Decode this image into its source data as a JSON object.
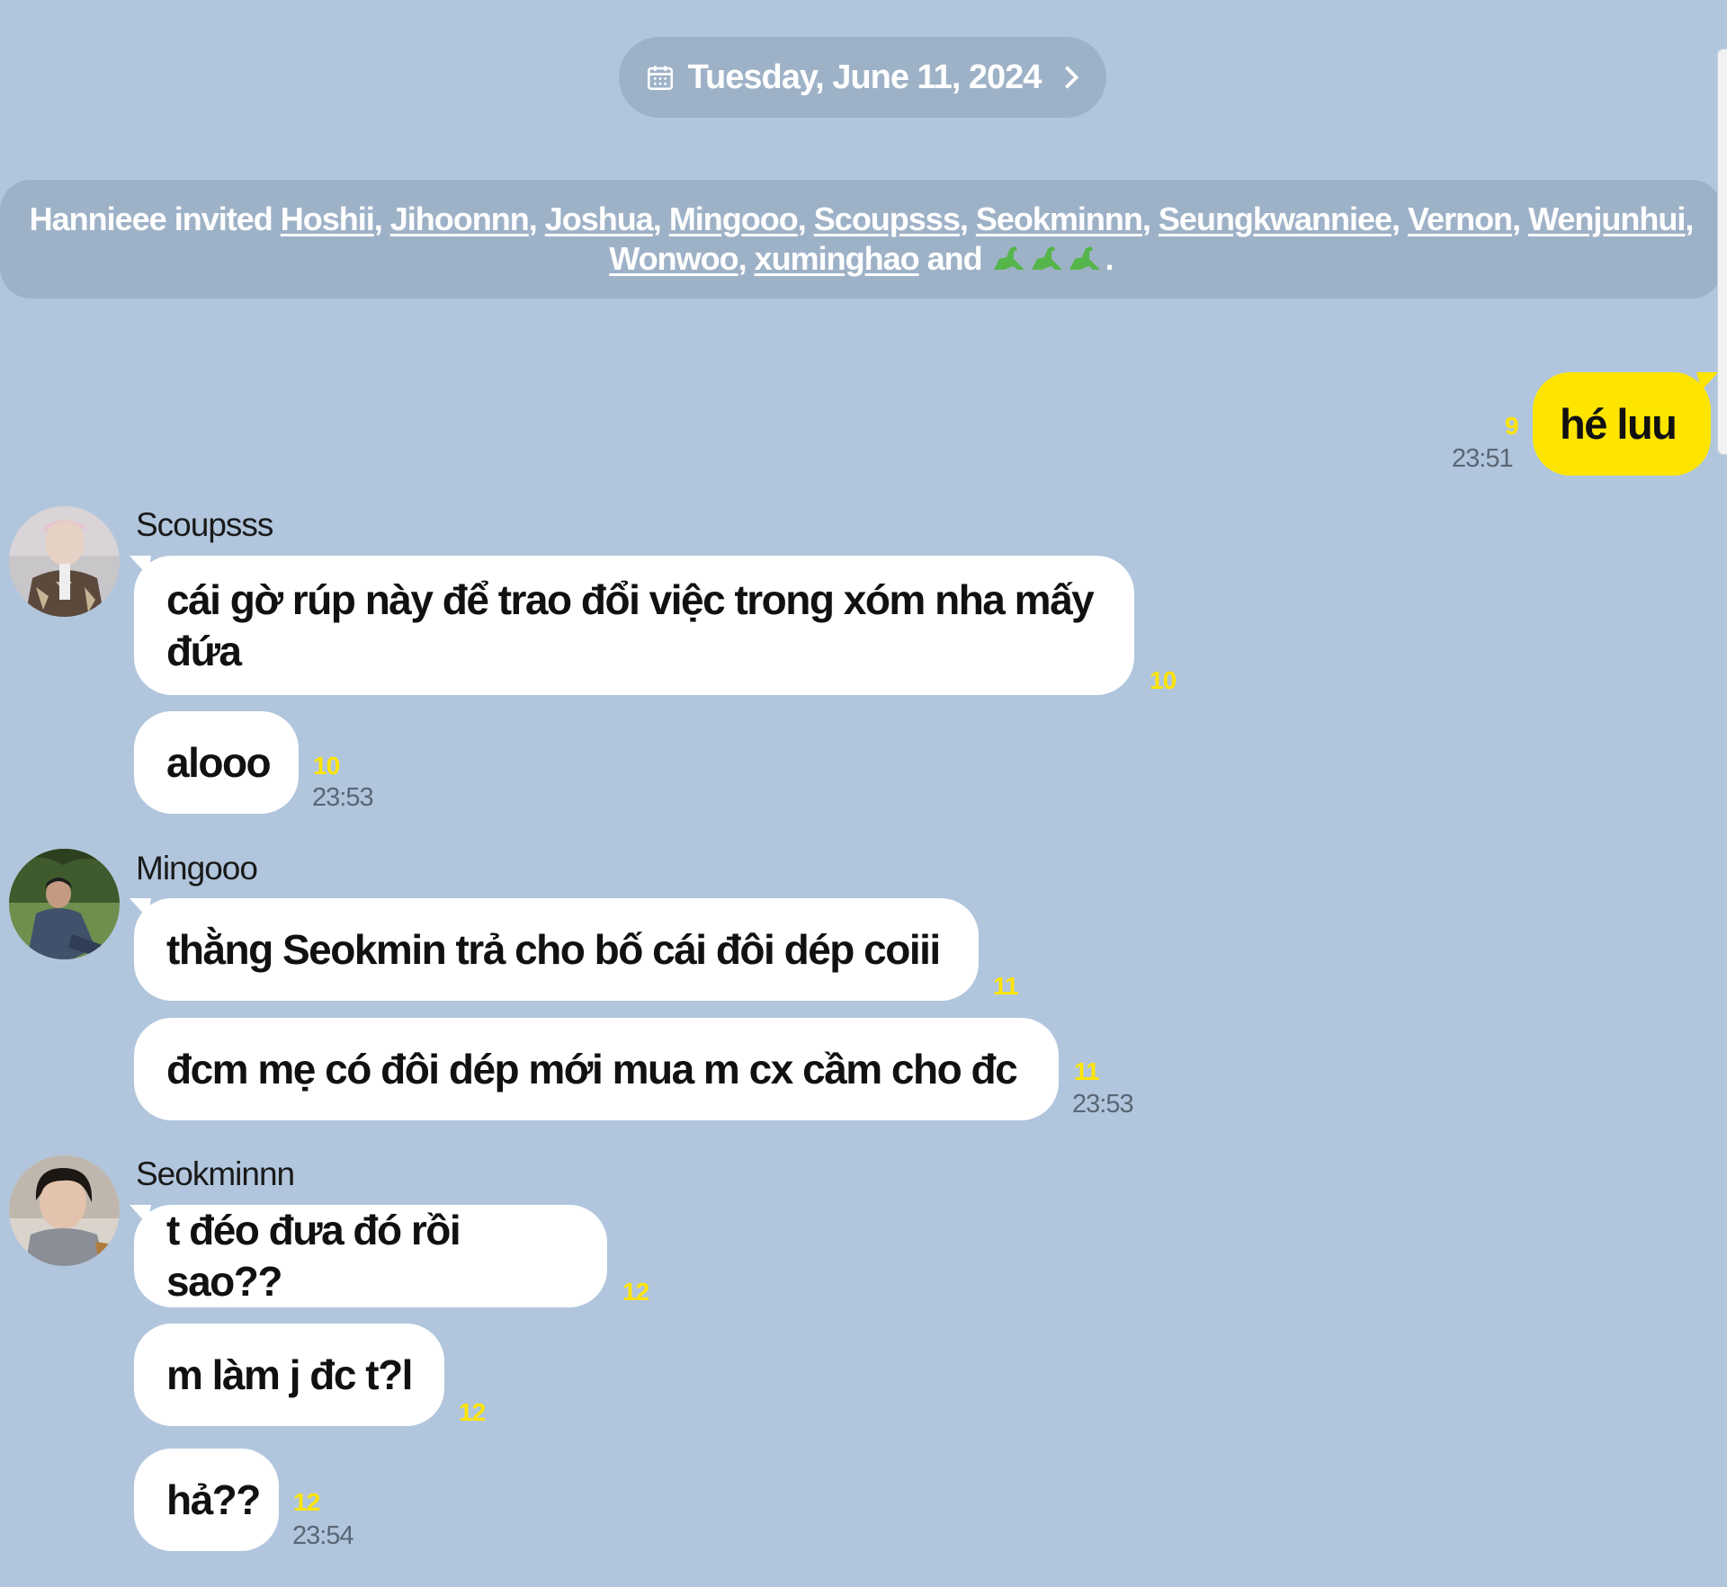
{
  "date_header": {
    "label": "Tuesday, June 11, 2024",
    "icon": "calendar-icon",
    "chevron": "chevron-right-icon"
  },
  "system_message": {
    "inviter": "Hannieee",
    "invited_word": "invited",
    "names": [
      "Hoshii",
      "Jihoonnn",
      "Joshua",
      "Mingooo",
      "Scoupsss",
      "Seokminnn",
      "Seungkwanniee",
      "Vernon",
      "Wenjunhui",
      "Wonwoo",
      "xuminghao"
    ],
    "and_word": "and",
    "last_name_icon": "dinosaur-emoji-icon"
  },
  "my_message": {
    "text": "hé luu",
    "unread": "9",
    "time": "23:51"
  },
  "groups": [
    {
      "sender": "Scoupsss",
      "messages": [
        {
          "text": "cái gờ rúp này để trao đổi việc trong xóm nha mấy đứa",
          "unread": "10"
        },
        {
          "text": "alooo",
          "unread": "10",
          "time": "23:53"
        }
      ]
    },
    {
      "sender": "Mingooo",
      "messages": [
        {
          "text": "thằng Seokmin trả cho bố cái đôi dép coiii",
          "unread": "11"
        },
        {
          "text": "đcm mẹ có đôi dép mới mua m cx cầm cho đc",
          "unread": "11",
          "time": "23:53"
        }
      ]
    },
    {
      "sender": "Seokminnn",
      "messages": [
        {
          "text": "t đéo đưa đó rồi sao??",
          "unread": "12"
        },
        {
          "text": "m làm j đc t?l",
          "unread": "12"
        },
        {
          "text": "hả??",
          "unread": "12",
          "time": "23:54"
        }
      ]
    }
  ],
  "colors": {
    "background": "#b1c6dd",
    "system_pill": "#9eb2c7",
    "my_bubble": "#fee500",
    "other_bubble": "#ffffff",
    "unread_count": "#fee500"
  }
}
